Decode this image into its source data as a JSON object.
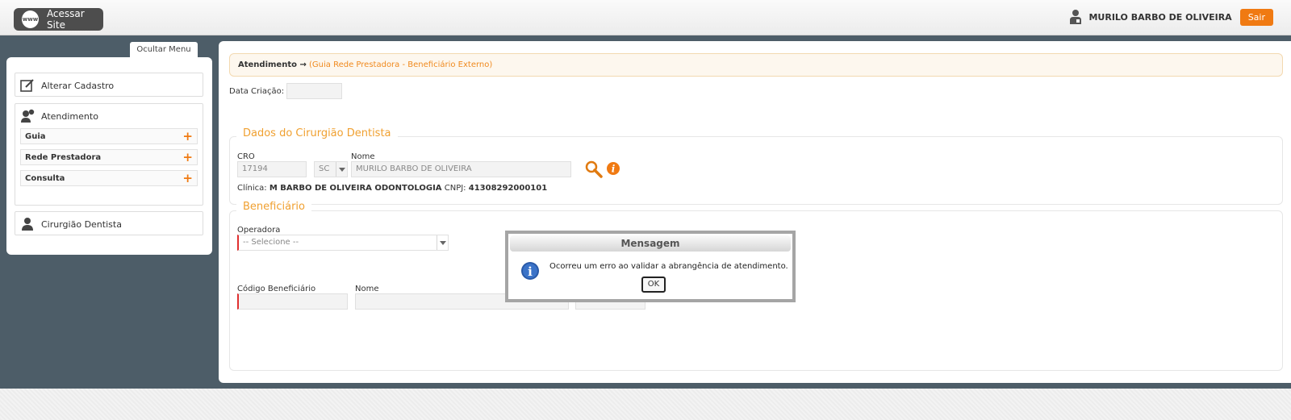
{
  "topbar": {
    "site_icon_text": "www",
    "site_button_label": "Acessar Site",
    "user_name": "MURILO BARBO DE OLIVEIRA",
    "logout_label": "Sair"
  },
  "sidebar": {
    "hide_menu_label": "Ocultar Menu",
    "alterar_cadastro": "Alterar Cadastro",
    "atendimento": "Atendimento",
    "submenu": [
      "Guia",
      "Rede Prestadora",
      "Consulta"
    ],
    "cirurgiao": "Cirurgião Dentista"
  },
  "breadcrumb": {
    "main": "Atendimento →",
    "sub": "(Guia Rede Prestadora - Beneficiário Externo)"
  },
  "form": {
    "data_criacao_label": "Data Criação:",
    "data_criacao_value": "",
    "dentista_legend": "Dados do Cirurgião Dentista",
    "cro_label": "CRO",
    "cro_value": "17194",
    "uf_value": "SC",
    "nome_label": "Nome",
    "nome_value": "MURILO BARBO DE OLIVEIRA",
    "clinica_label": "Clínica:",
    "clinica_value": "M BARBO DE OLIVEIRA ODONTOLOGIA",
    "cnpj_label": "CNPJ:",
    "cnpj_value": "41308292000101",
    "beneficiario_legend": "Beneficiário",
    "operadora_label": "Operadora",
    "operadora_value": "-- Selecione --",
    "codigo_label": "Código Beneficiário",
    "benef_nome_label": "Nome"
  },
  "modal": {
    "title": "Mensagem",
    "message": "Ocorreu um erro ao validar a abrangência de atendimento.",
    "ok_label": "OK"
  },
  "colors": {
    "accent": "#f07a12",
    "legend": "#f0a030",
    "dark_background": "#4d5d68"
  },
  "icons": [
    "www-icon",
    "user-icon",
    "edit-icon",
    "support-agent-icon",
    "plus-icon",
    "magnifier-icon",
    "info-icon",
    "dentist-icon"
  ]
}
